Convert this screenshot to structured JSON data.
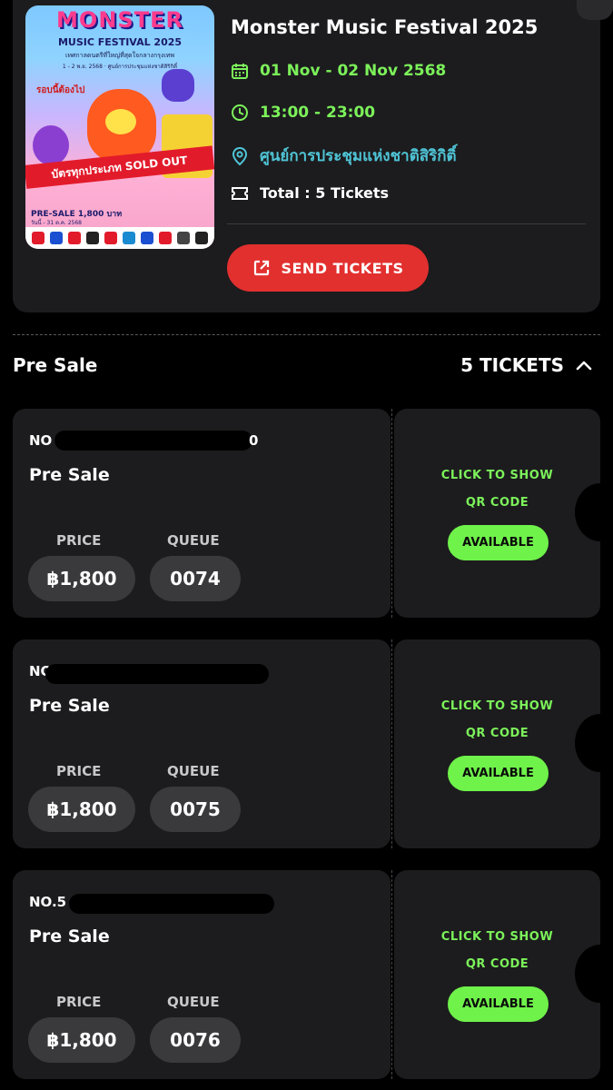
{
  "event": {
    "title": "Monster Music Festival 2025",
    "date": "01 Nov - 02 Nov 2568",
    "time": "13:00 - 23:00",
    "venue": "ศูนย์การประชุมแห่งชาติสิริกิติ์",
    "total": "Total : 5 Tickets",
    "send_label": "SEND TICKETS"
  },
  "poster": {
    "logo": "MONSTER",
    "subtitle": "MUSIC FESTIVAL 2025",
    "thai_line": "เทศกาลดนตรีที่ใหญ่ที่สุดใจกลางกรุงเทพ",
    "thai_line2": "1 - 2 พ.ย. 2568 · ศูนย์การประชุมแห่งชาติสิริกิติ์",
    "band_text": "บัตรทุกประเภท SOLD OUT",
    "note": "รอบนี้ต้องไป",
    "presale": "PRE-SALE 1,800 บาท",
    "dates_small": "วันนี้ - 31 ต.ค. 2568"
  },
  "section": {
    "title": "Pre Sale",
    "count": "5 TICKETS"
  },
  "tickets": [
    {
      "no": "NO",
      "no_tail": "0",
      "type": "Pre Sale",
      "price_label": "PRICE",
      "queue_label": "QUEUE",
      "price": "฿1,800",
      "queue": "0074",
      "qr_line1": "CLICK TO SHOW",
      "qr_line2": "QR CODE",
      "status": "AVAILABLE"
    },
    {
      "no": "NO",
      "no_tail": "",
      "type": "Pre Sale",
      "price_label": "PRICE",
      "queue_label": "QUEUE",
      "price": "฿1,800",
      "queue": "0075",
      "qr_line1": "CLICK TO SHOW",
      "qr_line2": "QR CODE",
      "status": "AVAILABLE"
    },
    {
      "no": "NO.5",
      "no_tail": "",
      "type": "Pre Sale",
      "price_label": "PRICE",
      "queue_label": "QUEUE",
      "price": "฿1,800",
      "queue": "0076",
      "qr_line1": "CLICK TO SHOW",
      "qr_line2": "QR CODE",
      "status": "AVAILABLE"
    }
  ],
  "colors": {
    "accent_green": "#7cf25a",
    "accent_teal": "#4fc4d6",
    "send_red": "#e2302f",
    "card_bg": "#1c1c1e"
  }
}
